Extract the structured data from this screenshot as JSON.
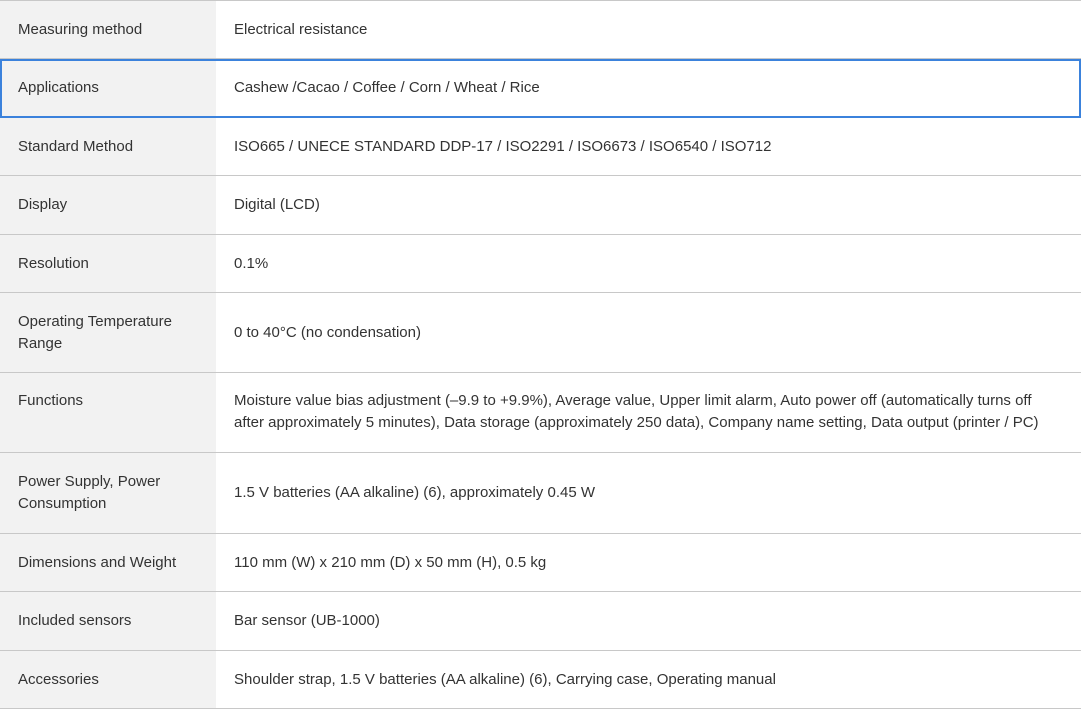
{
  "specs": [
    {
      "label": "Measuring method",
      "value": "Electrical resistance"
    },
    {
      "label": "Applications",
      "value": "Cashew /Cacao / Coffee / Corn / Wheat / Rice"
    },
    {
      "label": "Standard Method",
      "value": "ISO665 / UNECE STANDARD DDP-17 / ISO2291 / ISO6673 / ISO6540 / ISO712"
    },
    {
      "label": "Display",
      "value": "Digital (LCD)"
    },
    {
      "label": "Resolution",
      "value": "0.1%"
    },
    {
      "label": "Operating Temperature Range",
      "value": "0 to 40°C (no condensation)"
    },
    {
      "label": "Functions",
      "value": "Moisture value bias adjustment (–9.9 to +9.9%), Average value, Upper limit alarm, Auto power off (automatically turns off after approximately 5 minutes), Data storage (approximately 250 data), Company name setting, Data output (printer / PC)"
    },
    {
      "label": "Power Supply, Power Consumption",
      "value": "1.5 V batteries (AA alkaline) (6), approximately 0.45 W"
    },
    {
      "label": "Dimensions and Weight",
      "value": "110 mm (W) x 210 mm (D) x 50 mm (H), 0.5 kg"
    },
    {
      "label": "Included sensors",
      "value": "Bar sensor (UB-1000)"
    },
    {
      "label": "Accessories",
      "value": "Shoulder strap, 1.5 V batteries (AA alkaline) (6), Carrying case, Operating manual"
    }
  ]
}
